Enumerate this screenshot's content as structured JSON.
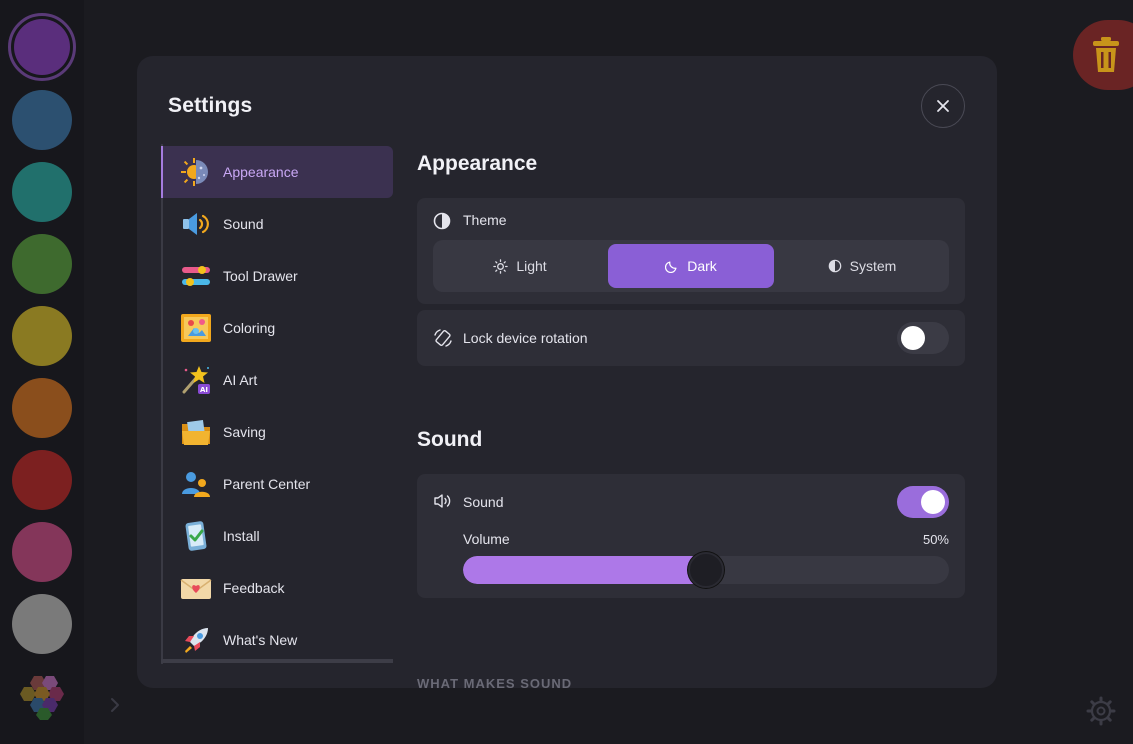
{
  "rail": {
    "colors": [
      "#5a2e7c",
      "#2c5070",
      "#21706c",
      "#3e6a2e",
      "#8a7a22",
      "#8a4e1c",
      "#7c2020",
      "#84365a",
      "#7a7a7a"
    ]
  },
  "modal": {
    "title": "Settings",
    "close_icon": "close-icon"
  },
  "nav": {
    "items": [
      {
        "label": "Appearance",
        "icon": "sun-moon-icon",
        "active": true
      },
      {
        "label": "Sound",
        "icon": "speaker-icon",
        "active": false
      },
      {
        "label": "Tool Drawer",
        "icon": "sliders-icon",
        "active": false
      },
      {
        "label": "Coloring",
        "icon": "picture-icon",
        "active": false
      },
      {
        "label": "AI Art",
        "icon": "magic-wand-icon",
        "active": false
      },
      {
        "label": "Saving",
        "icon": "folder-icon",
        "active": false
      },
      {
        "label": "Parent Center",
        "icon": "people-icon",
        "active": false
      },
      {
        "label": "Install",
        "icon": "phone-check-icon",
        "active": false
      },
      {
        "label": "Feedback",
        "icon": "envelope-heart-icon",
        "active": false
      },
      {
        "label": "What's New",
        "icon": "rocket-icon",
        "active": false
      }
    ]
  },
  "appearance": {
    "title": "Appearance",
    "theme_label": "Theme",
    "options": [
      {
        "label": "Light",
        "icon": "sun-icon"
      },
      {
        "label": "Dark",
        "icon": "moon-icon"
      },
      {
        "label": "System",
        "icon": "half-circle-icon"
      }
    ],
    "selected_theme": "Dark",
    "lock_rotation_label": "Lock device rotation",
    "lock_rotation_on": false
  },
  "sound": {
    "title": "Sound",
    "sound_label": "Sound",
    "sound_on": true,
    "volume_label": "Volume",
    "volume_value": "50%",
    "volume_fraction": 0.5,
    "what_makes_sound_heading": "WHAT MAKES SOUND"
  },
  "colors": {
    "accent": "#8a5fd6",
    "accent_light": "#ad78e8",
    "modal_bg": "#25252d",
    "card_bg": "#2e2e37"
  }
}
